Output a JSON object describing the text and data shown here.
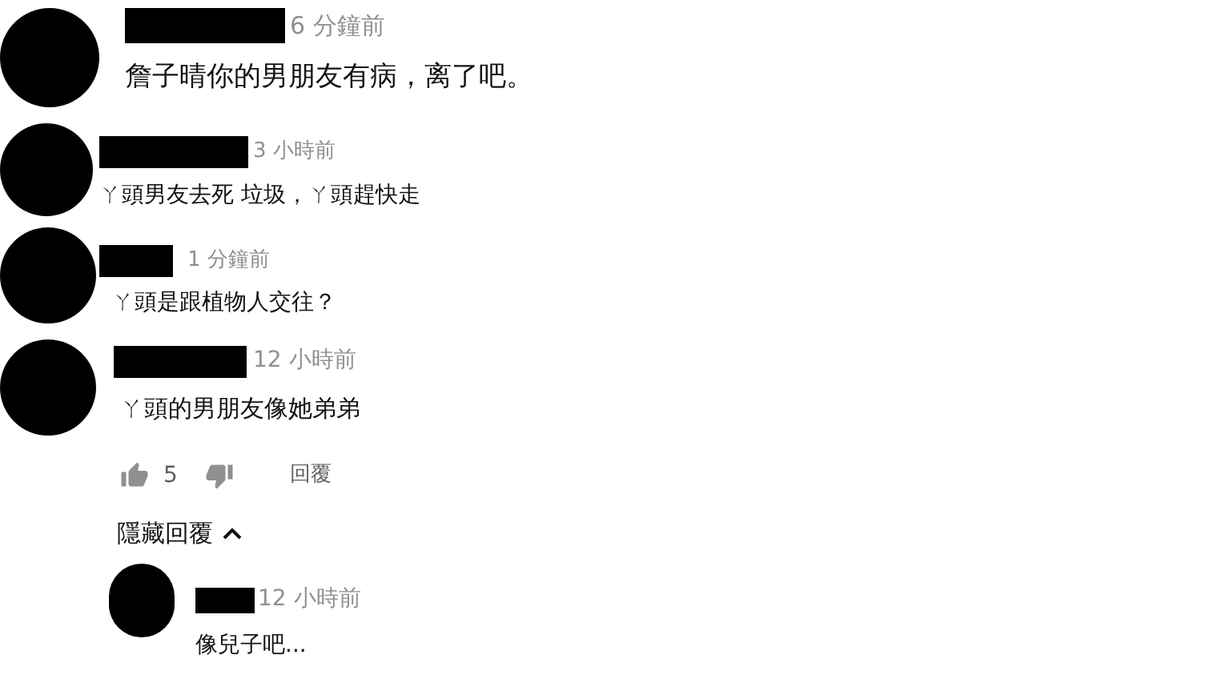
{
  "comments": [
    {
      "time": "6 分鐘前",
      "text": "詹子晴你的男朋友有病，离了吧。"
    },
    {
      "time": "3 小時前",
      "text": "ㄚ頭男友去死 垃圾，ㄚ頭趕快走"
    },
    {
      "time": "1 分鐘前",
      "text": "ㄚ頭是跟植物人交往？"
    },
    {
      "time": "12 小時前",
      "text": "ㄚ頭的男朋友像她弟弟",
      "likes": "5",
      "reply_label": "回覆",
      "toggle_label": "隱藏回覆",
      "expanded": true,
      "replies": [
        {
          "time": "12 小時前",
          "text": "像兒子吧..."
        }
      ]
    }
  ]
}
